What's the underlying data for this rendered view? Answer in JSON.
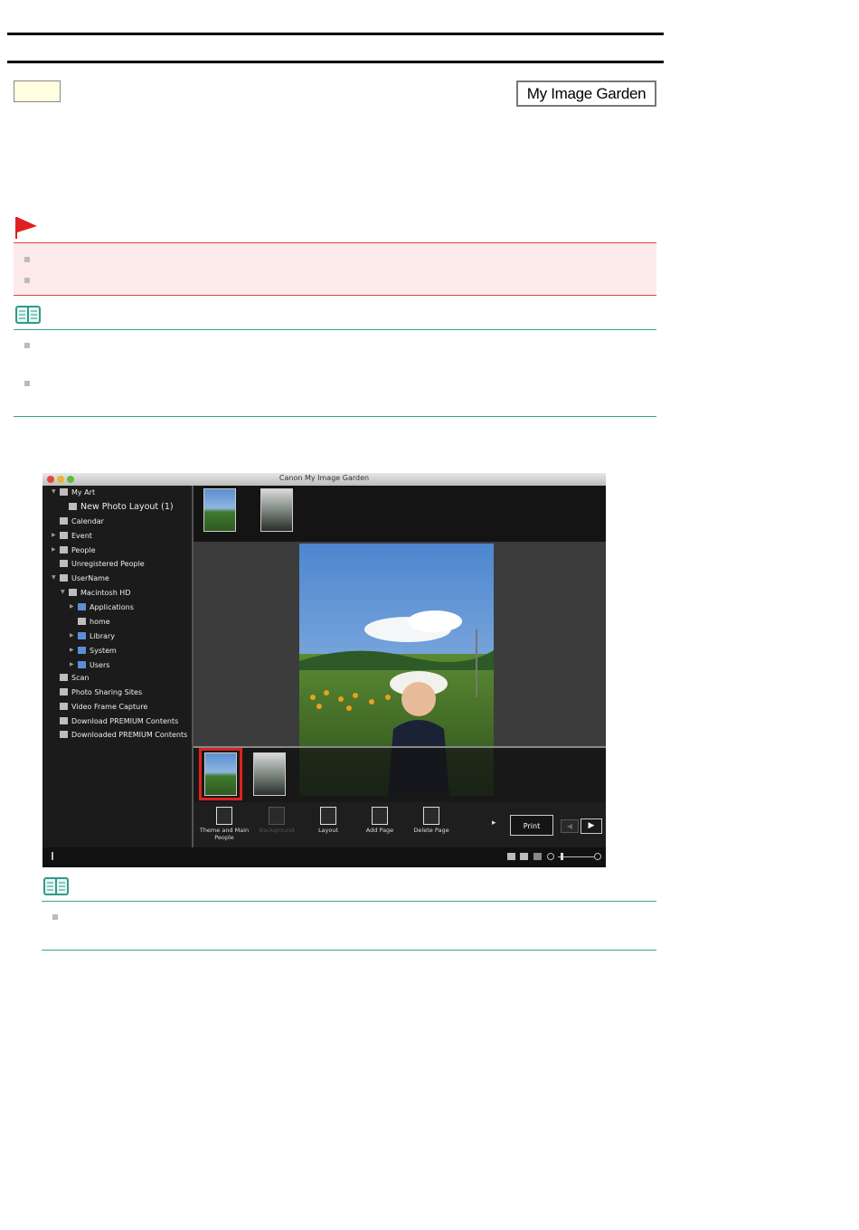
{
  "header": {
    "title_tag": "My Image Garden"
  },
  "app_window": {
    "title": "Canon My Image Garden",
    "sidebar": {
      "items": [
        {
          "label": "My Art"
        },
        {
          "label": "New Photo Layout (1)"
        },
        {
          "label": "Calendar"
        },
        {
          "label": "Event"
        },
        {
          "label": "People"
        },
        {
          "label": "Unregistered People"
        },
        {
          "label": "UserName"
        },
        {
          "label": "Macintosh HD"
        },
        {
          "label": "Applications"
        },
        {
          "label": "home"
        },
        {
          "label": "Library"
        },
        {
          "label": "System"
        },
        {
          "label": "Users"
        },
        {
          "label": "Scan"
        },
        {
          "label": "Photo Sharing Sites"
        },
        {
          "label": "Video Frame Capture"
        },
        {
          "label": "Download PREMIUM Contents"
        },
        {
          "label": "Downloaded PREMIUM Contents"
        }
      ]
    },
    "toolbar": {
      "theme_label": "Theme and Main People",
      "background_label": "Background",
      "layout_label": "Layout",
      "add_page_label": "Add Page",
      "delete_page_label": "Delete Page",
      "print_label": "Print"
    },
    "colors": {
      "selection_highlight": "#e02020",
      "important_accent": "#e34040",
      "note_accent": "#3aa393"
    }
  }
}
